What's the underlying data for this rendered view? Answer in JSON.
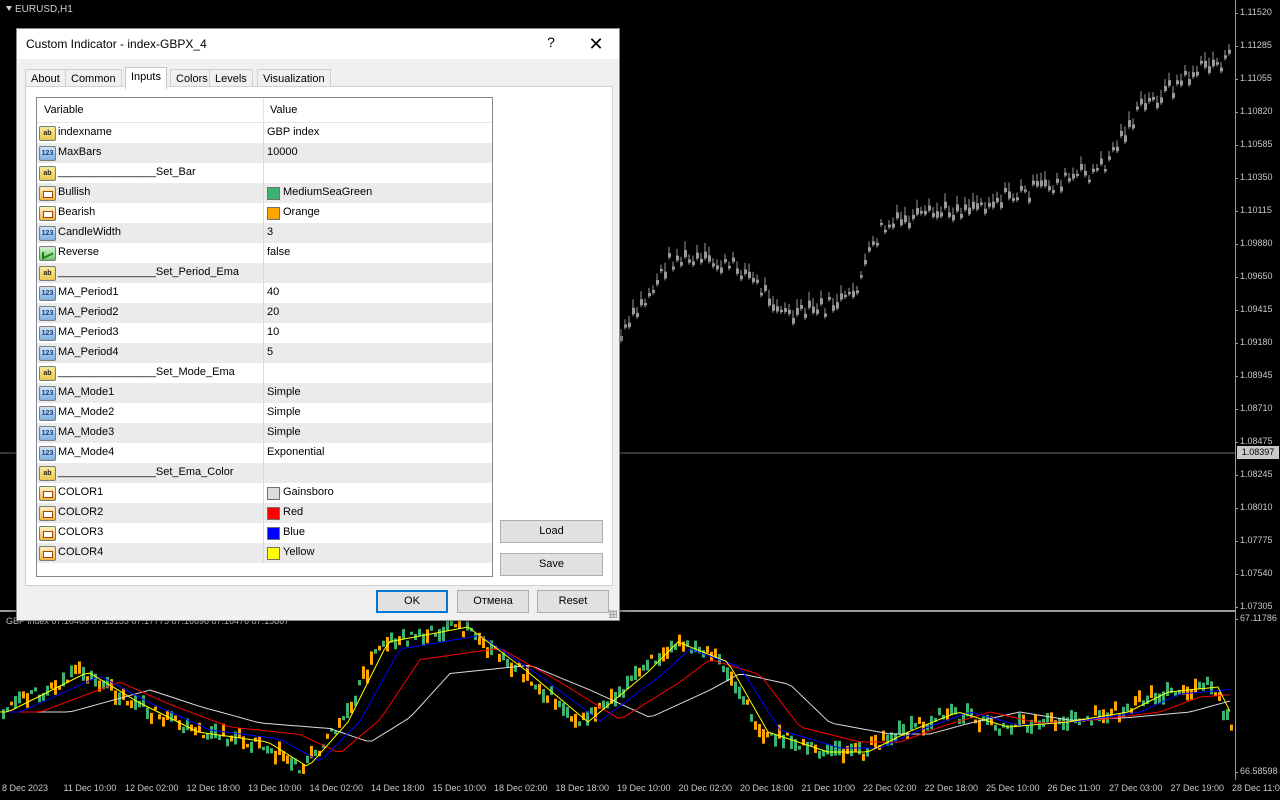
{
  "chart": {
    "symbol": "EURUSD,H1",
    "indicator_label": "GBP index 67.16460 67.15153 67.17775 67.16698 67.16476 67.15867",
    "price_ticks": [
      "1.11520",
      "1.11285",
      "1.11055",
      "1.10820",
      "1.10585",
      "1.10350",
      "1.10115",
      "1.09880",
      "1.09650",
      "1.09415",
      "1.09180",
      "1.08945",
      "1.08710",
      "1.08475",
      "1.08245",
      "1.08010",
      "1.07775",
      "1.07540",
      "1.07305"
    ],
    "current_price": "1.08397",
    "sub_price_top": "67.11786",
    "sub_price_bottom": "66.58598",
    "time_ticks": [
      "8 Dec 2023",
      "11 Dec 10:00",
      "12 Dec 02:00",
      "12 Dec 18:00",
      "13 Dec 10:00",
      "14 Dec 02:00",
      "14 Dec 18:00",
      "15 Dec 10:00",
      "18 Dec 02:00",
      "18 Dec 18:00",
      "19 Dec 10:00",
      "20 Dec 02:00",
      "20 Dec 18:00",
      "21 Dec 10:00",
      "22 Dec 02:00",
      "22 Dec 18:00",
      "25 Dec 10:00",
      "26 Dec 11:00",
      "27 Dec 03:00",
      "27 Dec 19:00",
      "28 Dec 11:00"
    ],
    "colors": {
      "bull": "#3cb371",
      "bear": "#ffa500",
      "ma1": "#dcdcdc",
      "ma2": "#ff0000",
      "ma3": "#0000ff",
      "ma4": "#ffff00",
      "main_candle": "#9a9a9a"
    }
  },
  "dialog": {
    "title": "Custom Indicator - index-GBPX_4",
    "help_glyph": "?",
    "close_glyph": "✕",
    "tabs": [
      {
        "label": "About",
        "active": false
      },
      {
        "label": "Common",
        "active": false
      },
      {
        "label": "Inputs",
        "active": true
      },
      {
        "label": "Colors",
        "active": false
      },
      {
        "label": "Levels",
        "active": false
      },
      {
        "label": "Visualization",
        "active": false
      }
    ],
    "grid_headers": {
      "variable": "Variable",
      "value": "Value"
    },
    "rows": [
      {
        "type": "str",
        "type_glyph": "ab",
        "name": "indexname",
        "value": "GBP index"
      },
      {
        "type": "int",
        "type_glyph": "123",
        "name": "MaxBars",
        "value": "10000"
      },
      {
        "type": "str",
        "type_glyph": "ab",
        "name": "________________Set_Bar",
        "value": ""
      },
      {
        "type": "color",
        "type_glyph": "",
        "name": "Bullish",
        "value": "MediumSeaGreen",
        "swatch": "#3cb371"
      },
      {
        "type": "color",
        "type_glyph": "",
        "name": "Bearish",
        "value": "Orange",
        "swatch": "#ffa500"
      },
      {
        "type": "int",
        "type_glyph": "123",
        "name": "CandleWidth",
        "value": "3"
      },
      {
        "type": "bool",
        "type_glyph": "",
        "name": "Reverse",
        "value": "false"
      },
      {
        "type": "str",
        "type_glyph": "ab",
        "name": "________________Set_Period_Ema",
        "value": ""
      },
      {
        "type": "int",
        "type_glyph": "123",
        "name": "MA_Period1",
        "value": "40"
      },
      {
        "type": "int",
        "type_glyph": "123",
        "name": "MA_Period2",
        "value": "20"
      },
      {
        "type": "int",
        "type_glyph": "123",
        "name": "MA_Period3",
        "value": "10"
      },
      {
        "type": "int",
        "type_glyph": "123",
        "name": "MA_Period4",
        "value": "5"
      },
      {
        "type": "str",
        "type_glyph": "ab",
        "name": "________________Set_Mode_Ema",
        "value": ""
      },
      {
        "type": "int",
        "type_glyph": "123",
        "name": "MA_Mode1",
        "value": "Simple"
      },
      {
        "type": "int",
        "type_glyph": "123",
        "name": "MA_Mode2",
        "value": "Simple"
      },
      {
        "type": "int",
        "type_glyph": "123",
        "name": "MA_Mode3",
        "value": "Simple"
      },
      {
        "type": "int",
        "type_glyph": "123",
        "name": "MA_Mode4",
        "value": "Exponential"
      },
      {
        "type": "str",
        "type_glyph": "ab",
        "name": "________________Set_Ema_Color",
        "value": ""
      },
      {
        "type": "color",
        "type_glyph": "",
        "name": "COLOR1",
        "value": "Gainsboro",
        "swatch": "#dcdcdc"
      },
      {
        "type": "color",
        "type_glyph": "",
        "name": "COLOR2",
        "value": "Red",
        "swatch": "#ff0000"
      },
      {
        "type": "color",
        "type_glyph": "",
        "name": "COLOR3",
        "value": "Blue",
        "swatch": "#0000ff"
      },
      {
        "type": "color",
        "type_glyph": "",
        "name": "COLOR4",
        "value": "Yellow",
        "swatch": "#ffff00"
      }
    ],
    "buttons": {
      "load": "Load",
      "save": "Save",
      "ok": "OK",
      "cancel": "Отмена",
      "reset": "Reset"
    }
  }
}
